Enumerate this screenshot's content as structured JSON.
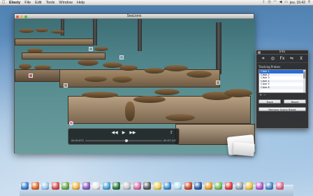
{
  "menubar": {
    "app": "Elasty",
    "items": [
      "File",
      "Edit",
      "Tools",
      "Window",
      "Help"
    ],
    "clock": "jeu. 16:42"
  },
  "video_window": {
    "title": "SeaLions",
    "time_elapsed": "00:01:672",
    "time_remaining": "-00:07:107",
    "progress_fraction": 0.52
  },
  "info_panel": {
    "title": "Info",
    "tools": [
      "crop-icon",
      "target-icon",
      "fx-icon",
      "blend-icon",
      "mirror-icon"
    ],
    "tool_glyphs": [
      "⌗",
      "◎",
      "Fx",
      "⇋",
      "⊻"
    ],
    "tracking_label": "Tracking Probes",
    "probes": [
      "Cible 1",
      "Cible 2",
      "Cible 3",
      "Cible 4",
      "Cible 5",
      "Cible 6"
    ],
    "selected_probe": 0,
    "track_button": "Track",
    "reset_button": "Reset",
    "remove_button": "Remove Scene Break"
  },
  "dock": {
    "icon_colors": [
      "#3a7fd0",
      "#e06a2a",
      "#9ec8ee",
      "#d84b4b",
      "#6aa94b",
      "#f1b94a",
      "#8a5bbf",
      "#e8e8e8",
      "#4ca3d8",
      "#2a7b3c",
      "#c7c7c7",
      "#d86fa8",
      "#5a5a5a",
      "#e9d35a",
      "#3f8fd1",
      "#b8e4f4",
      "#cc4a2b",
      "#2e5fa7",
      "#ea9f2f",
      "#7bbd5c",
      "#db3f3f",
      "#9aa6b3",
      "#f0c640",
      "#b45cc7",
      "#4b89c6",
      "#e36c8f"
    ]
  }
}
